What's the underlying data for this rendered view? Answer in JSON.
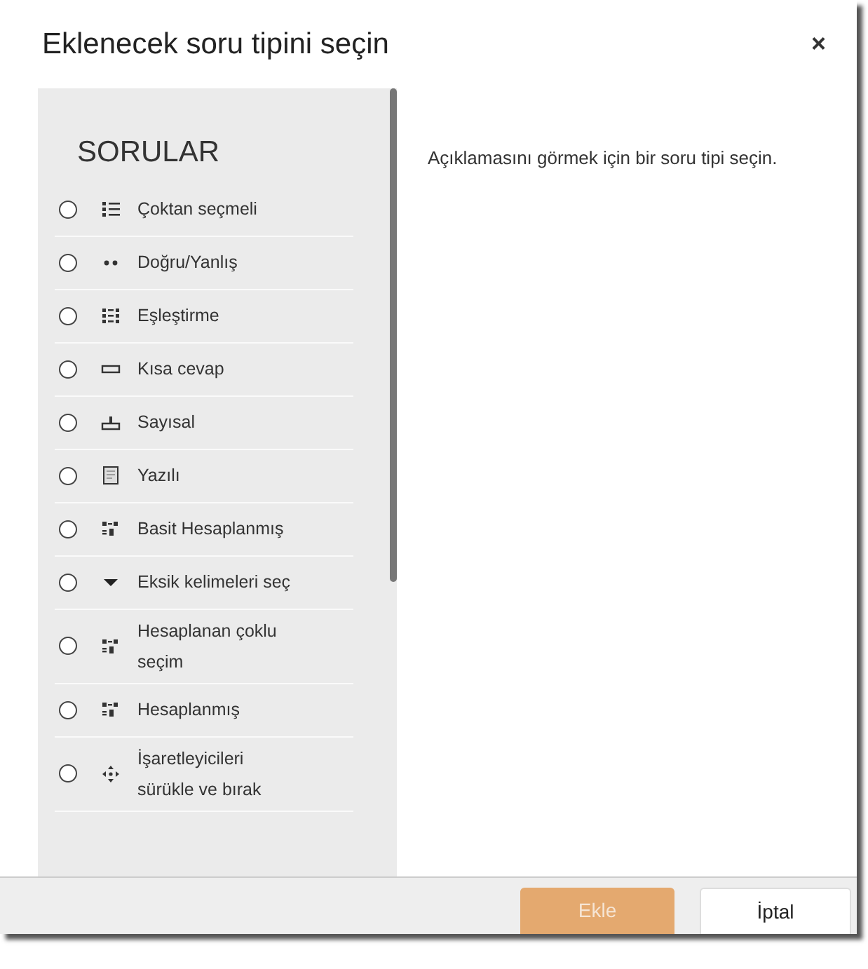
{
  "dialog": {
    "title": "Eklenecek soru tipini seçin",
    "close": "×"
  },
  "sidebar": {
    "heading": "SORULAR",
    "items": [
      {
        "label": "Çoktan seçmeli",
        "kind": "list",
        "selected": false
      },
      {
        "label": "Doğru/Yanlış",
        "kind": "dots",
        "selected": false
      },
      {
        "label": "Eşleştirme",
        "kind": "grid",
        "selected": false
      },
      {
        "label": "Kısa cevap",
        "kind": "field",
        "selected": false
      },
      {
        "label": "Sayısal",
        "kind": "numeric",
        "selected": false
      },
      {
        "label": "Yazılı",
        "kind": "document",
        "selected": false
      },
      {
        "label": "Basit Hesaplanmış",
        "kind": "formula",
        "selected": false
      },
      {
        "label": "Eksik kelimeleri seç",
        "kind": "dropdown",
        "selected": false
      },
      {
        "label": "Hesaplanan çoklu seçim",
        "kind": "formula",
        "selected": false
      },
      {
        "label": "Hesaplanmış",
        "kind": "formula",
        "selected": false
      },
      {
        "label": "İşaretleyicileri sürükle ve bırak",
        "kind": "move",
        "selected": false
      }
    ]
  },
  "description": "Açıklamasını görmek için bir soru tipi seçin.",
  "buttons": [
    {
      "label": "Ekle",
      "kind": "primary",
      "disabled": true
    },
    {
      "label": "İptal",
      "kind": "secondary",
      "disabled": false
    }
  ]
}
